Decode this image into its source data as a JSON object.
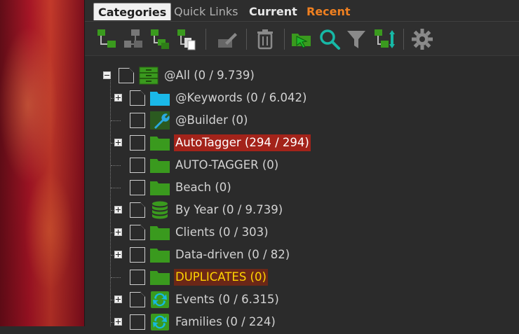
{
  "tabs": [
    {
      "label": "Categories",
      "active": true,
      "color": "#202020"
    },
    {
      "label": "Quick Links",
      "active": false,
      "color": "#b0b0b0"
    },
    {
      "label": "Current",
      "active": false,
      "color": "#e8e8e8"
    },
    {
      "label": "Recent",
      "active": false,
      "color": "#f08020"
    }
  ],
  "toolbar": [
    {
      "name": "new-category-icon",
      "tip": ""
    },
    {
      "name": "new-subcategory-icon",
      "tip": ""
    },
    {
      "name": "duplicate-category-icon",
      "tip": ""
    },
    {
      "name": "copy-category-icon",
      "tip": ""
    },
    {
      "name": "rename-category-icon",
      "tip": ""
    },
    {
      "name": "delete-icon",
      "tip": ""
    },
    {
      "name": "move-to-category-icon",
      "tip": ""
    },
    {
      "name": "search-icon",
      "tip": ""
    },
    {
      "name": "filter-icon",
      "tip": ""
    },
    {
      "name": "sort-icon",
      "tip": ""
    },
    {
      "name": "settings-icon",
      "tip": ""
    }
  ],
  "tree": [
    {
      "label": "@All (0 / 9.739)",
      "icon": "cabinet-icon",
      "expander": "minus",
      "check": "partial",
      "level": 0,
      "highlight": "none"
    },
    {
      "label": "@Keywords (0 / 6.042)",
      "icon": "folder-blue-icon",
      "expander": "plus",
      "check": "partial",
      "level": 1,
      "highlight": "none"
    },
    {
      "label": "@Builder (0)",
      "icon": "wrench-icon",
      "expander": "none",
      "check": "empty",
      "level": 1,
      "highlight": "none"
    },
    {
      "label": "AutoTagger (294 / 294)",
      "icon": "folder-green-icon",
      "expander": "plus",
      "check": "empty",
      "level": 1,
      "highlight": "red"
    },
    {
      "label": "AUTO-TAGGER (0)",
      "icon": "folder-green-icon",
      "expander": "none",
      "check": "empty",
      "level": 1,
      "highlight": "none"
    },
    {
      "label": "Beach (0)",
      "icon": "folder-green-icon",
      "expander": "none",
      "check": "empty",
      "level": 1,
      "highlight": "none"
    },
    {
      "label": "By Year (0 / 9.739)",
      "icon": "database-icon",
      "expander": "plus",
      "check": "partial",
      "level": 1,
      "highlight": "none"
    },
    {
      "label": "Clients (0 / 303)",
      "icon": "folder-green-icon",
      "expander": "plus",
      "check": "partial",
      "level": 1,
      "highlight": "none"
    },
    {
      "label": "Data-driven (0 / 82)",
      "icon": "folder-green-icon",
      "expander": "plus",
      "check": "empty",
      "level": 1,
      "highlight": "none"
    },
    {
      "label": "DUPLICATES (0)",
      "icon": "folder-green-icon",
      "expander": "none",
      "check": "empty",
      "level": 1,
      "highlight": "dup"
    },
    {
      "label": "Events (0 / 6.315)",
      "icon": "sync-icon",
      "expander": "plus",
      "check": "partial",
      "level": 1,
      "highlight": "none"
    },
    {
      "label": "Families (0 / 224)",
      "icon": "sync-icon",
      "expander": "plus",
      "check": "empty",
      "level": 1,
      "highlight": "none"
    }
  ],
  "colors": {
    "folder_green": "#3a9a1e",
    "folder_blue": "#1ab8e8",
    "highlight_red": "#a3231a",
    "highlight_dup_bg": "#6b2717",
    "highlight_dup_text": "#ffd400",
    "recent_tab": "#f08020"
  }
}
